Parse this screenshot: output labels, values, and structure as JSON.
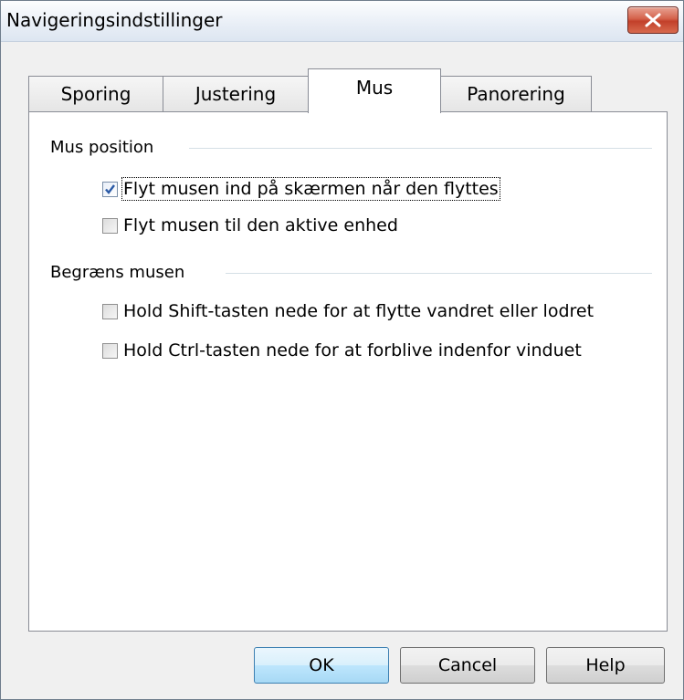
{
  "window": {
    "title": "Navigeringsindstillinger"
  },
  "tabs": [
    {
      "label": "Sporing"
    },
    {
      "label": "Justering"
    },
    {
      "label": "Mus"
    },
    {
      "label": "Panorering"
    }
  ],
  "active_tab": "Mus",
  "mouse_position": {
    "label": "Mus position",
    "options": [
      {
        "label": "Flyt musen ind på skærmen når den flyttes",
        "checked": true
      },
      {
        "label": "Flyt musen til den aktive enhed",
        "checked": false
      }
    ]
  },
  "limit_mouse": {
    "label": "Begræns musen",
    "options": [
      {
        "label": "Hold Shift-tasten nede for at flytte vandret eller lodret",
        "checked": false
      },
      {
        "label": "Hold Ctrl-tasten nede for at forblive indenfor vinduet",
        "checked": false
      }
    ]
  },
  "buttons": {
    "ok": "OK",
    "cancel": "Cancel",
    "help": "Help"
  }
}
